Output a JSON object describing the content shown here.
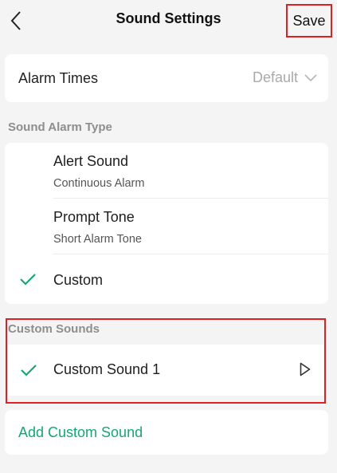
{
  "header": {
    "title": "Sound Settings",
    "save_label": "Save",
    "highlight_color": "#e02020"
  },
  "alarm_times": {
    "label": "Alarm Times",
    "value": "Default"
  },
  "sound_alarm_type": {
    "section_label": "Sound Alarm Type",
    "options": [
      {
        "title": "Alert Sound",
        "subtitle": "Continuous Alarm",
        "selected": false
      },
      {
        "title": "Prompt Tone",
        "subtitle": "Short Alarm Tone",
        "selected": false
      },
      {
        "title": "Custom",
        "subtitle": "",
        "selected": true
      }
    ]
  },
  "custom_sounds": {
    "section_label": "Custom Sounds",
    "items": [
      {
        "title": "Custom Sound 1",
        "selected": true
      }
    ],
    "add_label": "Add Custom Sound"
  },
  "colors": {
    "accent": "#13a872",
    "background": "#f4f4f4",
    "muted_text": "#a9a9a9"
  },
  "icons": {
    "back": "chevron-left-icon",
    "dropdown": "chevron-down-icon",
    "check": "checkmark-icon",
    "play": "play-icon"
  }
}
